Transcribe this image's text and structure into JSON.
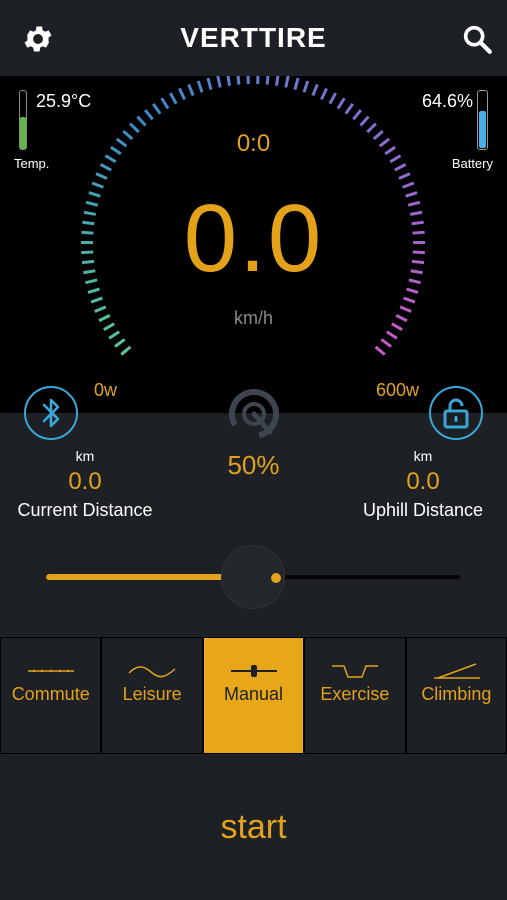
{
  "header": {
    "title": "VERTTIRE",
    "settings_icon": "gear-icon",
    "search_icon": "search-icon"
  },
  "dashboard": {
    "temperature": {
      "value": "25.9°C",
      "label": "Temp.",
      "level": 0.55,
      "color": "#67b34a"
    },
    "battery": {
      "value": "64.6%",
      "label": "Battery",
      "level": 0.646,
      "color": "#49aee6"
    },
    "time": "0:0",
    "speed": "0.0",
    "speed_unit": "km/h",
    "power_min": "0w",
    "power_max": "600w",
    "power_fraction": 0
  },
  "controls": {
    "bluetooth_icon": "bluetooth-icon",
    "lock_icon": "unlock-icon",
    "assist_icon": "assist-gauge-icon",
    "assist_level": "50%",
    "current_distance": {
      "unit": "km",
      "value": "0.0",
      "label": "Current Distance"
    },
    "uphill_distance": {
      "unit": "km",
      "value": "0.0",
      "label": "Uphill Distance"
    },
    "slider_value": 0.5
  },
  "modes": [
    {
      "label": "Commute",
      "icon": "commute-icon",
      "active": false
    },
    {
      "label": "Leisure",
      "icon": "leisure-icon",
      "active": false
    },
    {
      "label": "Manual",
      "icon": "manual-icon",
      "active": true
    },
    {
      "label": "Exercise",
      "icon": "exercise-icon",
      "active": false
    },
    {
      "label": "Climbing",
      "icon": "climbing-icon",
      "active": false
    }
  ],
  "start_label": "start",
  "colors": {
    "accent": "#e3a21a",
    "background": "#1d2024",
    "bluetooth": "#39a7d8"
  }
}
